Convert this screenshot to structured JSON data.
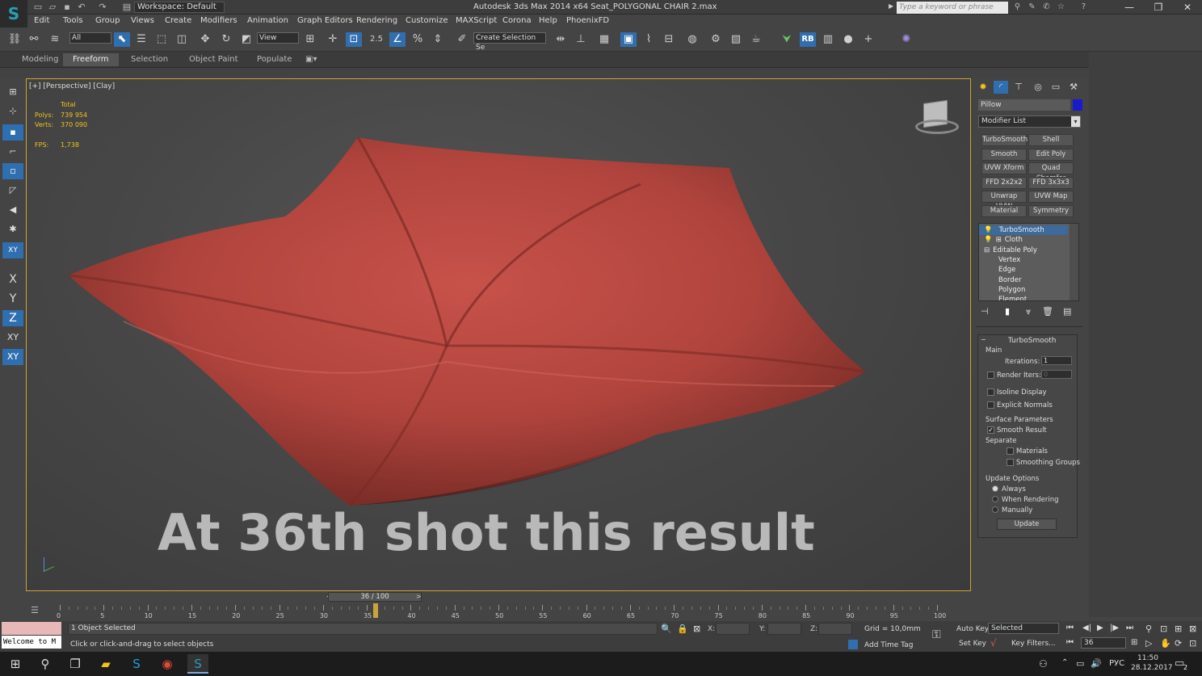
{
  "window": {
    "title": "Autodesk 3ds Max  2014 x64     Seat_POLYGONAL CHAIR 2.max",
    "workspace": "Workspace: Default",
    "search_placeholder": "Type a keyword or phrase"
  },
  "menu": [
    "Edit",
    "Tools",
    "Group",
    "Views",
    "Create",
    "Modifiers",
    "Animation",
    "Graph Editors",
    "Rendering",
    "Customize",
    "MAXScript",
    "Corona",
    "Help",
    "PhoenixFD"
  ],
  "toolbar": {
    "selection_filter": "All",
    "ref_coord": "View",
    "snap_value": "2.5",
    "selection_set": "Create Selection Se",
    "rb_label": "RB"
  },
  "ribbon": {
    "tabs": [
      "Modeling",
      "Freeform",
      "Selection",
      "Object Paint",
      "Populate"
    ],
    "active": "Freeform"
  },
  "left_tools": {
    "x": "X",
    "y": "Y",
    "z": "Z",
    "xy": "XY",
    "xy2": "XY"
  },
  "viewport": {
    "label": "[+] [Perspective] [Clay]",
    "stats_total": "Total",
    "polys_label": "Polys:",
    "polys": "739 954",
    "verts_label": "Verts:",
    "verts": "370 090",
    "fps_label": "FPS:",
    "fps": "1,738",
    "caption": "At 36th shot this result"
  },
  "panel": {
    "object_name": "Pillow",
    "object_color": "#1a1acd",
    "modifier_list": "Modifier List",
    "buttons": [
      "TurboSmooth",
      "Shell",
      "Smooth",
      "Edit Poly",
      "UVW Xform",
      "Quad Chamfer",
      "FFD 2x2x2",
      "FFD 3x3x3",
      "Unwrap UVW",
      "UVW Map",
      "Material",
      "Symmetry"
    ],
    "stack": [
      "TurboSmooth",
      "Cloth",
      "Editable Poly",
      "Vertex",
      "Edge",
      "Border",
      "Polygon",
      "Element"
    ],
    "rollout": {
      "title": "TurboSmooth",
      "main": "Main",
      "iterations_label": "Iterations:",
      "iterations": "1",
      "render_iters_label": "Render Iters:",
      "render_iters": "0",
      "isoline": "Isoline Display",
      "explicit_normals": "Explicit Normals",
      "surface_params": "Surface Parameters",
      "smooth_result": "Smooth Result",
      "separate": "Separate",
      "materials": "Materials",
      "smoothing_groups": "Smoothing Groups",
      "update_options": "Update Options",
      "always": "Always",
      "when_rendering": "When Rendering",
      "manually": "Manually",
      "update": "Update"
    }
  },
  "timeline": {
    "frame": "36 / 100",
    "prev": "<",
    "next": ">",
    "current": 36,
    "max": 100,
    "ticks": [
      "0",
      "5",
      "10",
      "15",
      "20",
      "25",
      "30",
      "35",
      "40",
      "45",
      "50",
      "55",
      "60",
      "65",
      "70",
      "75",
      "80",
      "85",
      "90",
      "95",
      "100"
    ]
  },
  "status": {
    "selected": "1 Object Selected",
    "prompt": "Click or click-and-drag to select objects",
    "welcome": "Welcome to M",
    "x_label": "X:",
    "y_label": "Y:",
    "z_label": "Z:",
    "grid": "Grid = 10,0mm",
    "add_time_tag": "Add Time Tag",
    "auto_key": "Auto Key",
    "set_key": "Set Key",
    "selected_mode": "Selected",
    "key_filters": "Key Filters...",
    "current_frame": "36"
  },
  "taskbar": {
    "lang": "РУС",
    "time": "11:50",
    "date": "28.12.2017",
    "notifications": "2"
  }
}
